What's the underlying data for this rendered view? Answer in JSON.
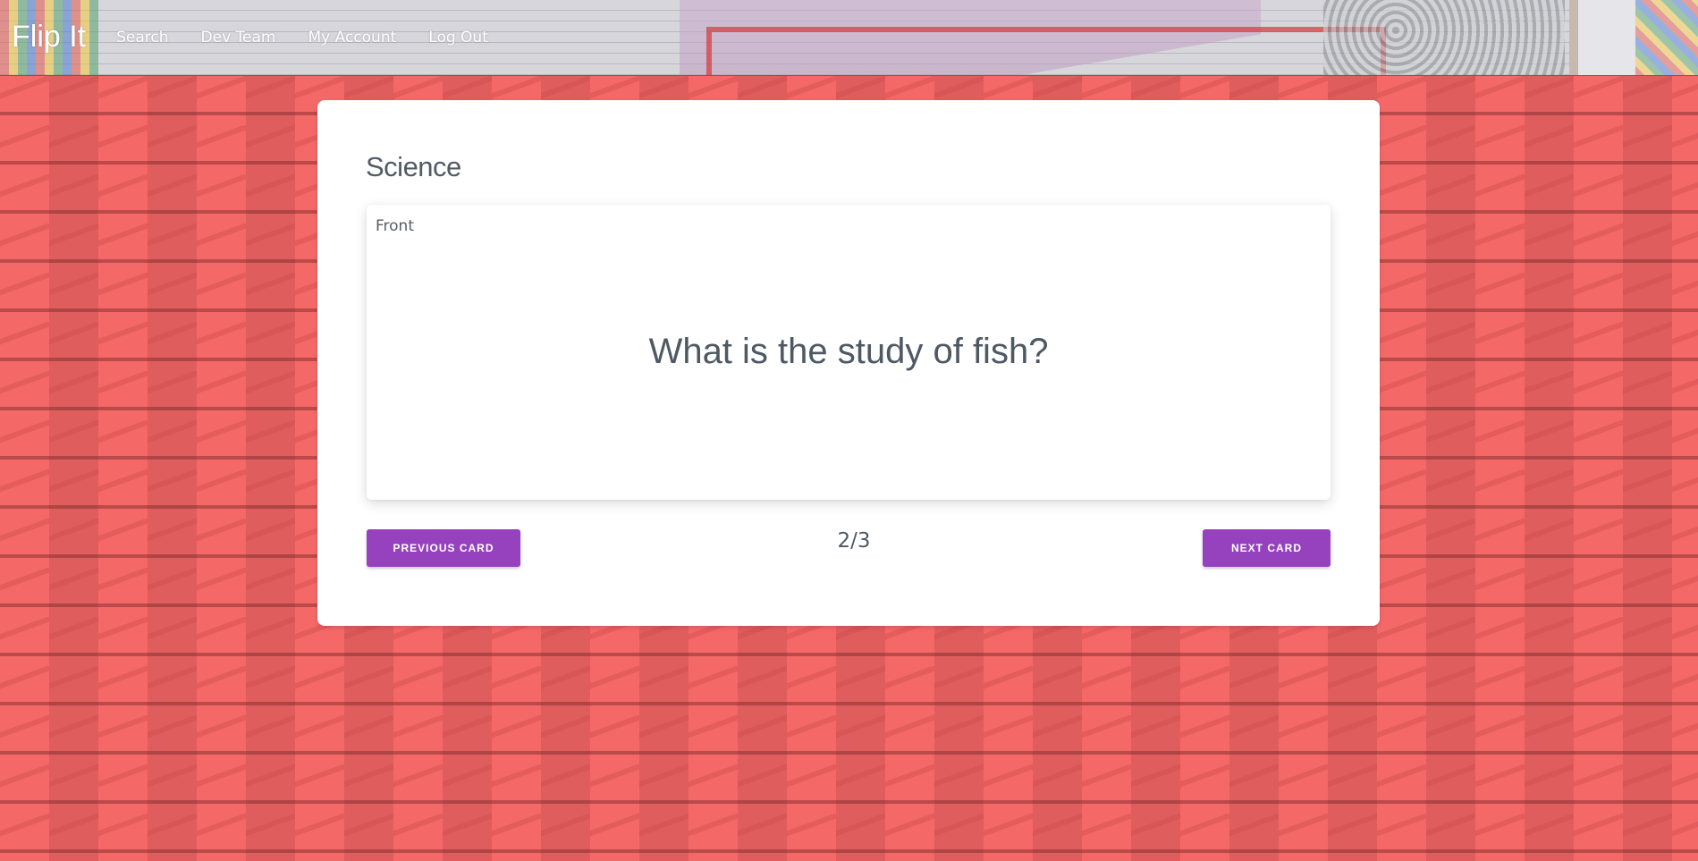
{
  "navbar": {
    "brand": "Flip It",
    "links": [
      {
        "label": "Search"
      },
      {
        "label": "Dev Team"
      },
      {
        "label": "My Account"
      },
      {
        "label": "Log Out"
      }
    ]
  },
  "deck": {
    "title": "Science"
  },
  "card": {
    "side_label": "Front",
    "text": "What is the study of fish?"
  },
  "controls": {
    "previous_label": "Previous Card",
    "next_label": "Next Card",
    "counter": "2/3"
  },
  "colors": {
    "background_red": "#f56868",
    "button_purple": "#9641be",
    "text_gray": "#4e5964"
  }
}
